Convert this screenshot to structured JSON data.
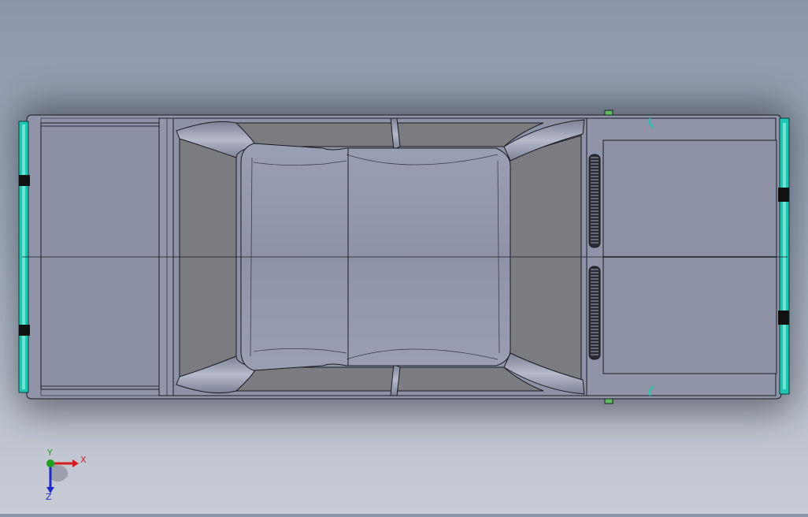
{
  "viewport": {
    "background_top": "#8b97a8",
    "background_bottom": "#c8ccd6",
    "model_body_color": "#8f94a8",
    "model_edge_color": "#1b1c22",
    "glass_color": "#7a7c80",
    "light_color": "#1fc6b2"
  },
  "triad": {
    "x_label": "X",
    "y_label": "Y",
    "z_label": "Z",
    "x_color": "#d21e1e",
    "y_color": "#1ea01e",
    "z_color": "#1e28c8"
  }
}
